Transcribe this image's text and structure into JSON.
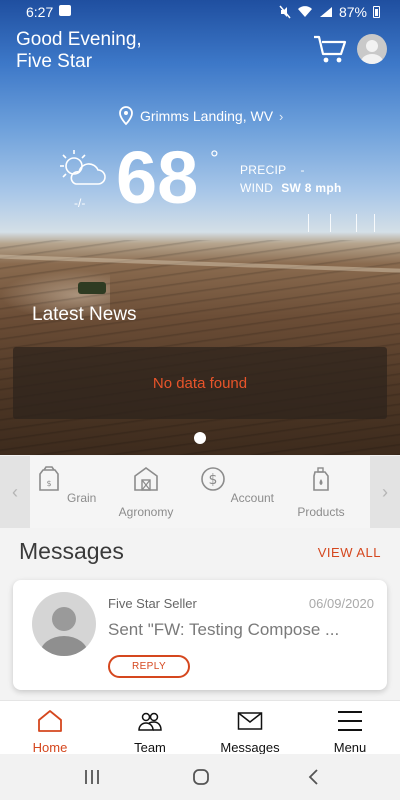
{
  "status_bar": {
    "time": "6:27",
    "battery": "87%"
  },
  "header": {
    "greeting": "Good Evening,\nFive Star"
  },
  "weather": {
    "location": "Grimms Landing, WV",
    "temperature": "68",
    "degree_symbol": "°",
    "icon_caption": "-/-",
    "precip_label": "PRECIP",
    "precip_value": "-",
    "wind_label": "WIND",
    "wind_value": "SW 8 mph"
  },
  "news": {
    "title": "Latest News",
    "empty_text": "No data found"
  },
  "quick_links": [
    {
      "label": "Grain",
      "icon": "grain-bag-icon"
    },
    {
      "label": "Agronomy",
      "icon": "barn-icon"
    },
    {
      "label": "Account",
      "icon": "dollar-coin-icon"
    },
    {
      "label": "Products",
      "icon": "product-jug-icon"
    }
  ],
  "messages": {
    "title": "Messages",
    "view_all": "VIEW ALL",
    "items": [
      {
        "sender": "Five Star Seller",
        "date": "06/09/2020",
        "preview": "Sent \"FW: Testing Compose ...",
        "reply_label": "REPLY"
      }
    ]
  },
  "bottom_nav": [
    {
      "label": "Home",
      "icon": "home-icon",
      "active": true
    },
    {
      "label": "Team",
      "icon": "team-icon",
      "active": false
    },
    {
      "label": "Messages",
      "icon": "envelope-icon",
      "active": false
    },
    {
      "label": "Menu",
      "icon": "menu-icon",
      "active": false
    }
  ],
  "colors": {
    "accent": "#d5471e",
    "nav_active": "#d5471e"
  }
}
